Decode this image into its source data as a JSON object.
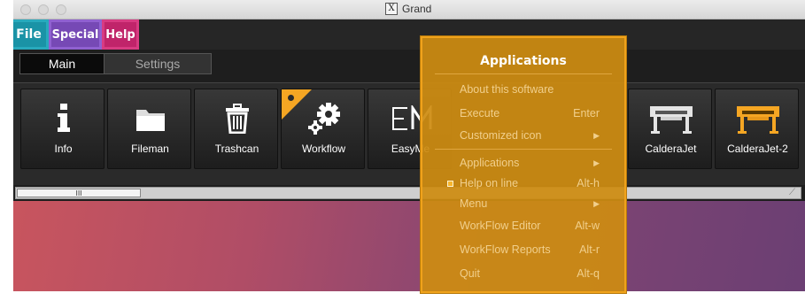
{
  "window": {
    "title": "Grand"
  },
  "menubar": {
    "items": [
      "File",
      "Special",
      "Help"
    ]
  },
  "tabs": [
    "Main",
    "Settings"
  ],
  "toolbar": {
    "tiles": [
      {
        "label": "Info",
        "icon": "info-icon"
      },
      {
        "label": "Fileman",
        "icon": "folder-icon"
      },
      {
        "label": "Trashcan",
        "icon": "trash-icon"
      },
      {
        "label": "Workflow",
        "icon": "gears-icon"
      },
      {
        "label": "EasyMe",
        "icon": "easymedia-icon"
      },
      {
        "label": "CalderaJet",
        "icon": "printer-icon"
      },
      {
        "label": "CalderaJet-2",
        "icon": "printer-icon"
      }
    ],
    "scroll_thumb": "III"
  },
  "dropdown": {
    "title": "Applications",
    "items": [
      {
        "label": "About this software",
        "shortcut": ""
      },
      {
        "label": "Execute",
        "shortcut": "Enter"
      },
      {
        "label": "Customized icon",
        "shortcut": "▶"
      },
      {
        "label": "Applications",
        "shortcut": "▶"
      },
      {
        "label": "Help on line",
        "shortcut": "Alt-h",
        "checked": true
      },
      {
        "label": "Menu",
        "shortcut": "▶"
      },
      {
        "label": "WorkFlow Editor",
        "shortcut": "Alt-w"
      },
      {
        "label": "WorkFlow Reports",
        "shortcut": "Alt-r"
      },
      {
        "label": "Quit",
        "shortcut": "Alt-q"
      }
    ]
  },
  "colors": {
    "file": "#1a93a6",
    "special": "#7649b5",
    "help": "#c0246a",
    "menu_bg": "#ce8c11",
    "accent": "#f5a623"
  }
}
